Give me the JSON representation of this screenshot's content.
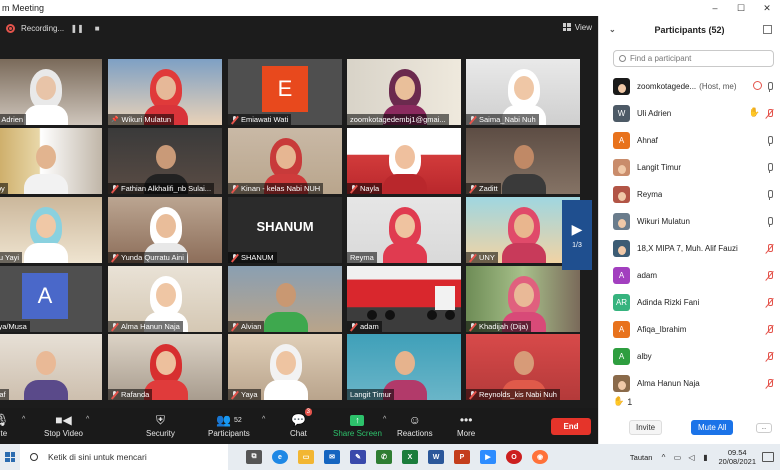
{
  "window": {
    "title": "m Meeting"
  },
  "recording": {
    "label": "Recording..."
  },
  "view": {
    "label": "View"
  },
  "tiles": [
    {
      "name": "Uli Adrien",
      "muted": false
    },
    {
      "name": "Wikuri Mulatun",
      "muted": false,
      "pinned": true
    },
    {
      "name": "Emiawati Wati",
      "muted": true,
      "letter": "E"
    },
    {
      "name": "zoomkotagedembj1@gmai...",
      "muted": false
    },
    {
      "name": "Saima_Nabi Nuh",
      "muted": true
    },
    {
      "name": "alby",
      "muted": false
    },
    {
      "name": "Fathian Alkhalifi_nb Sulai...",
      "muted": true
    },
    {
      "name": "Kinan - kelas Nabi NUH",
      "muted": true
    },
    {
      "name": "Nayla",
      "muted": true
    },
    {
      "name": "Zaditt",
      "muted": true
    },
    {
      "name": "ayu Yayi",
      "muted": false
    },
    {
      "name": "Yunda Qurratu Aini",
      "muted": true
    },
    {
      "name": "SHANUM",
      "muted": true,
      "bigname": "SHANUM"
    },
    {
      "name": "Reyma",
      "muted": false
    },
    {
      "name": "UNY",
      "muted": true
    },
    {
      "name": "Qiya/Musa",
      "muted": false,
      "letter": "A"
    },
    {
      "name": "Alma Hanun Naja",
      "muted": true
    },
    {
      "name": "Alvian",
      "muted": true
    },
    {
      "name": "adam",
      "muted": true
    },
    {
      "name": "Khadijah (Dija)",
      "muted": true
    },
    {
      "name": "nnaf",
      "muted": false
    },
    {
      "name": "Rafanda",
      "muted": true
    },
    {
      "name": "Yaya",
      "muted": true
    },
    {
      "name": "Langit Timur",
      "muted": false
    },
    {
      "name": "Reynolds_kis Nabi Nuh",
      "muted": true
    }
  ],
  "pager": {
    "label": "1/3"
  },
  "toolbar": {
    "mute": "ute",
    "video": "Stop Video",
    "security": "Security",
    "participants": "Participants",
    "participants_count": "52",
    "chat": "Chat",
    "chat_badge": "3",
    "share": "Share Screen",
    "reactions": "Reactions",
    "more": "More",
    "end": "End"
  },
  "panel": {
    "title": "Participants (52)",
    "search_placeholder": "Find a participant",
    "participants": [
      {
        "name": "zoomkotagede...",
        "extra": "(Host, me)",
        "avatar": "img",
        "color": "#1a1a1a",
        "icons": [
          "cam",
          "mic"
        ]
      },
      {
        "name": "Uli Adrien",
        "avatar": "W",
        "color": "#4d5a66",
        "icons": [
          "hand",
          "mic-muted"
        ]
      },
      {
        "name": "Ahnaf",
        "avatar": "A",
        "color": "#e8721c",
        "icons": [
          "mic"
        ]
      },
      {
        "name": "Langit Timur",
        "avatar": "img",
        "color": "#c98c6b",
        "icons": [
          "mic"
        ]
      },
      {
        "name": "Reyma",
        "avatar": "img",
        "color": "#b25546",
        "icons": [
          "mic"
        ]
      },
      {
        "name": "Wikuri Mulatun",
        "avatar": "img",
        "color": "#6a7c8c",
        "icons": [
          "mic"
        ]
      },
      {
        "name": "18,X MIPA 7, Muh. Alif Fauzi",
        "avatar": "img",
        "color": "#3c5c74",
        "icons": [
          "mic-muted"
        ]
      },
      {
        "name": "adam",
        "avatar": "A",
        "color": "#a23fbf",
        "icons": [
          "mic-muted"
        ]
      },
      {
        "name": "Adinda Rizki Fani",
        "avatar": "AR",
        "color": "#36b37e",
        "icons": [
          "mic-muted"
        ]
      },
      {
        "name": "Afiqa_Ibrahim",
        "avatar": "A",
        "color": "#e8721c",
        "icons": [
          "mic-muted"
        ]
      },
      {
        "name": "alby",
        "avatar": "A",
        "color": "#2e9e3f",
        "icons": [
          "mic-muted"
        ]
      },
      {
        "name": "Alma Hanun Naja",
        "avatar": "img",
        "color": "#8a6a4a",
        "icons": [
          "mic-muted"
        ]
      }
    ],
    "reaction_count": "1",
    "invite": "Invite",
    "mute_all": "Mute All",
    "more": "..."
  },
  "taskbar": {
    "search_text": "Ketik di sini untuk mencari",
    "tautan": "Tautan",
    "time": "09.54",
    "date": "20/08/2021"
  }
}
